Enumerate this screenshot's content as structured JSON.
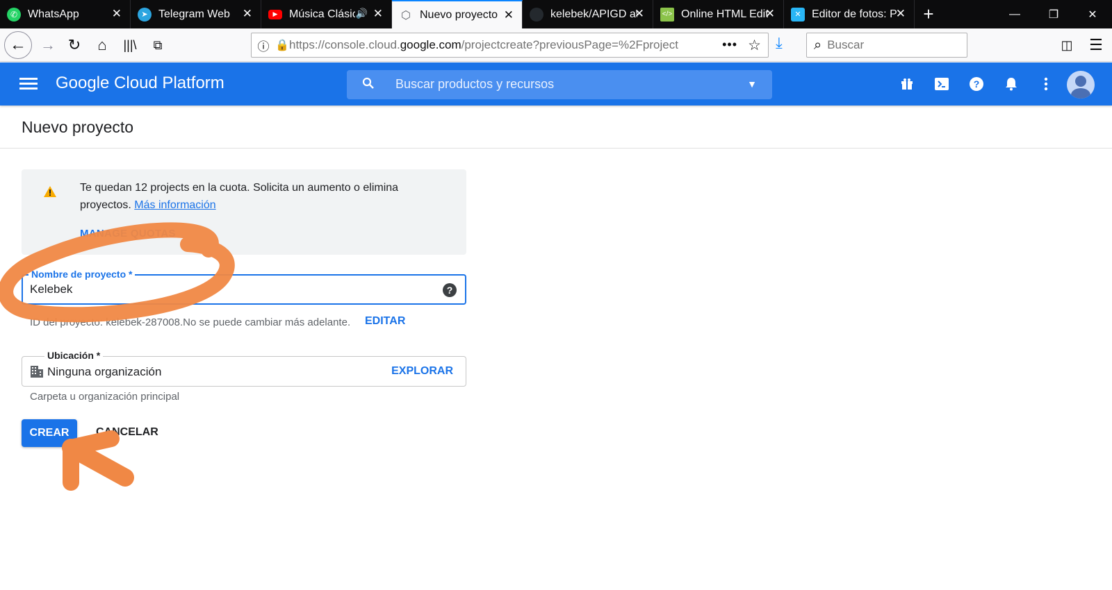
{
  "browser": {
    "tabs": [
      {
        "label": "WhatsApp",
        "icon": "whatsapp-icon",
        "active": false
      },
      {
        "label": "Telegram Web",
        "icon": "telegram-icon",
        "active": false
      },
      {
        "label": "Música Clásica",
        "icon": "youtube-icon",
        "active": false,
        "playing_audio": true
      },
      {
        "label": "Nuevo proyecto – ",
        "icon": "gcp-icon",
        "active": true
      },
      {
        "label": "kelebek/APIGD at",
        "icon": "github-icon",
        "active": false
      },
      {
        "label": "Online HTML Edit",
        "icon": "html-editor-icon",
        "active": false
      },
      {
        "label": "Editor de fotos: P",
        "icon": "photo-editor-icon",
        "active": false
      }
    ],
    "url_prefix": "https://console.cloud.",
    "url_domain": "google.com",
    "url_rest": "/projectcreate?previousPage=%2Fproject",
    "search_placeholder": "Buscar"
  },
  "gcp": {
    "brand": "Google Cloud Platform",
    "search_placeholder": "Buscar productos y recursos",
    "brand_color": "#1a73e8"
  },
  "page": {
    "title": "Nuevo proyecto",
    "quota": {
      "text": "Te quedan 12 projects en la cuota. Solicita un aumento o elimina proyectos.",
      "link": "Más información",
      "manage": "MANAGE QUOTAS"
    },
    "name_field": {
      "label": "Nombre de proyecto *",
      "value": "Kelebek"
    },
    "project_id_text": "ID del proyecto: kelebek-287008.No se puede cambiar más adelante.",
    "edit_label": "EDITAR",
    "location_field": {
      "label": "Ubicación *",
      "value": "Ninguna organización",
      "browse": "EXPLORAR",
      "hint": "Carpeta u organización principal"
    },
    "create_button": "CREAR",
    "cancel_button": "CANCELAR"
  }
}
